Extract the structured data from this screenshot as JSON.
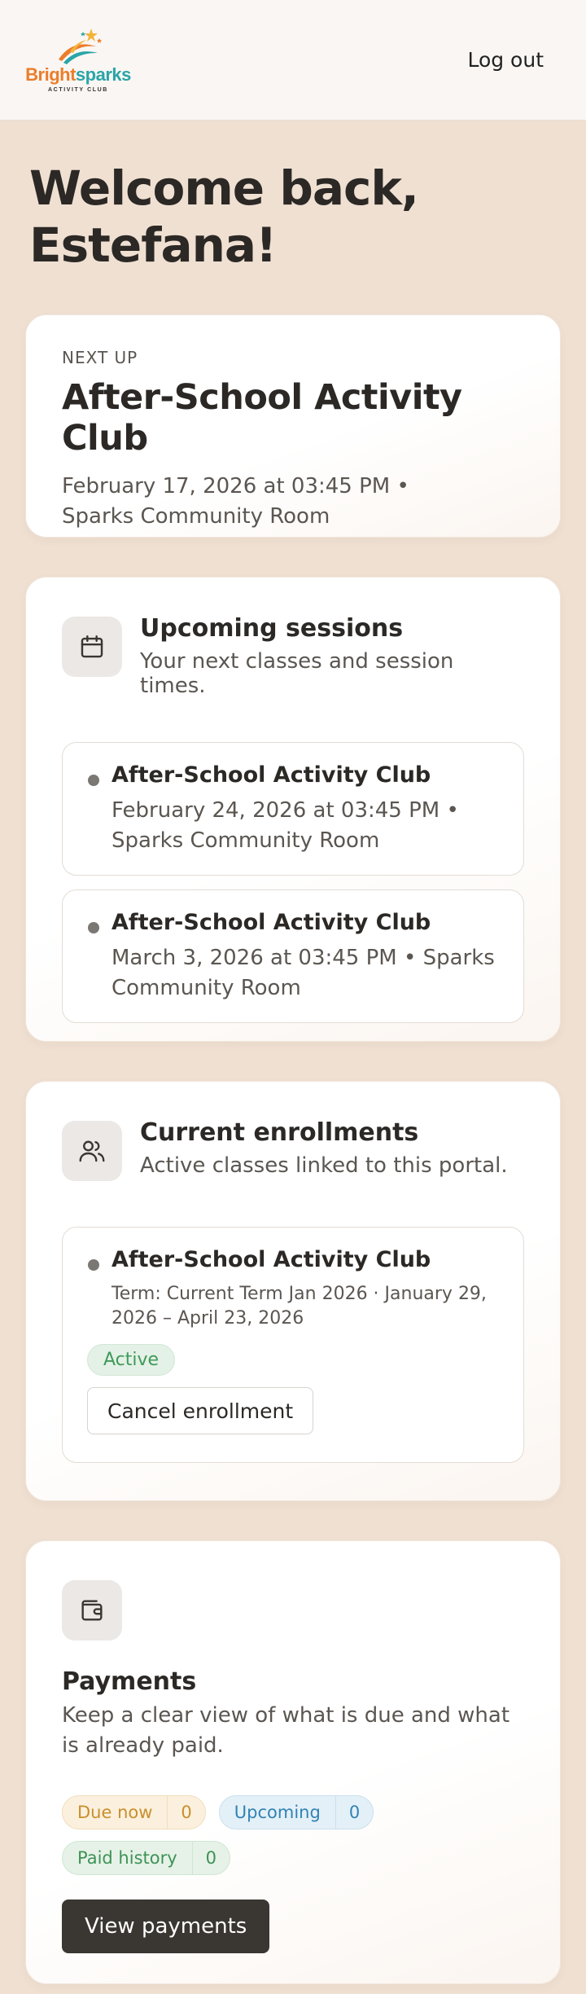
{
  "header": {
    "logo_word_1": "Bright",
    "logo_word_2": "sparks",
    "logo_sub": "ACTIVITY CLUB",
    "logout_label": "Log out"
  },
  "welcome": {
    "line1": "Welcome back,",
    "line2": "Estefana!"
  },
  "next_up": {
    "eyebrow": "NEXT UP",
    "title": "After-School Activity Club",
    "meta": "February 17, 2026 at 03:45 PM • Sparks Community Room"
  },
  "sessions": {
    "title": "Upcoming sessions",
    "subtitle": "Your next classes and session times.",
    "items": [
      {
        "title": "After-School Activity Club",
        "meta": "February 24, 2026 at 03:45 PM • Sparks Community Room"
      },
      {
        "title": "After-School Activity Club",
        "meta": "March 3, 2026 at 03:45 PM • Sparks Community Room"
      }
    ]
  },
  "enrollments": {
    "title": "Current enrollments",
    "subtitle": "Active classes linked to this portal.",
    "items": [
      {
        "title": "After-School Activity Club",
        "term": "Term: Current Term Jan 2026 · January 29, 2026 – April 23, 2026",
        "status": "Active",
        "cancel_label": "Cancel enrollment"
      }
    ]
  },
  "payments": {
    "title": "Payments",
    "subtitle": "Keep a clear view of what is due and what is already paid.",
    "due_label": "Due now",
    "due_count": "0",
    "upcoming_label": "Upcoming",
    "upcoming_count": "0",
    "paid_label": "Paid history",
    "paid_count": "0",
    "view_label": "View payments"
  },
  "icons": {
    "sessions": "calendar-icon",
    "enrollments": "users-icon",
    "payments": "wallet-icon"
  },
  "colors": {
    "background": "#efe0d2",
    "primary_button": "#3a3631",
    "active_green": "#3f9a5a"
  }
}
